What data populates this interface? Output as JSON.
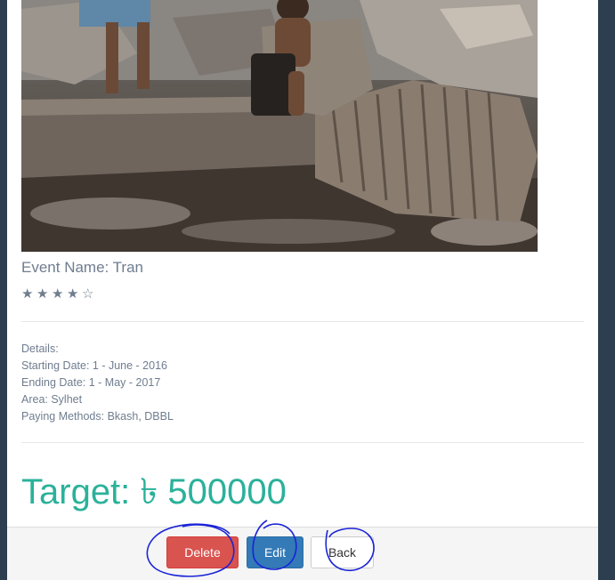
{
  "event": {
    "name_line": "Event Name: Tran",
    "rating": {
      "value": 4,
      "max": 5,
      "filled_glyph": "★",
      "empty_glyph": "☆"
    }
  },
  "details": {
    "heading": "Details:",
    "starting_date": "Starting Date: 1 - June - 2016",
    "ending_date": "Ending Date: 1 - May - 2017",
    "area": "Area: Sylhet",
    "paying_methods": "Paying Methods: Bkash, DBBL"
  },
  "target": {
    "text": "Target: ৳ 500000"
  },
  "actions": {
    "delete_label": "Delete",
    "edit_label": "Edit",
    "back_label": "Back"
  },
  "colors": {
    "accent_teal": "#2bb19a",
    "danger": "#d9534f",
    "primary": "#337ab7",
    "page_background": "#2c3e50",
    "annotation_ink": "#1a24d6"
  }
}
